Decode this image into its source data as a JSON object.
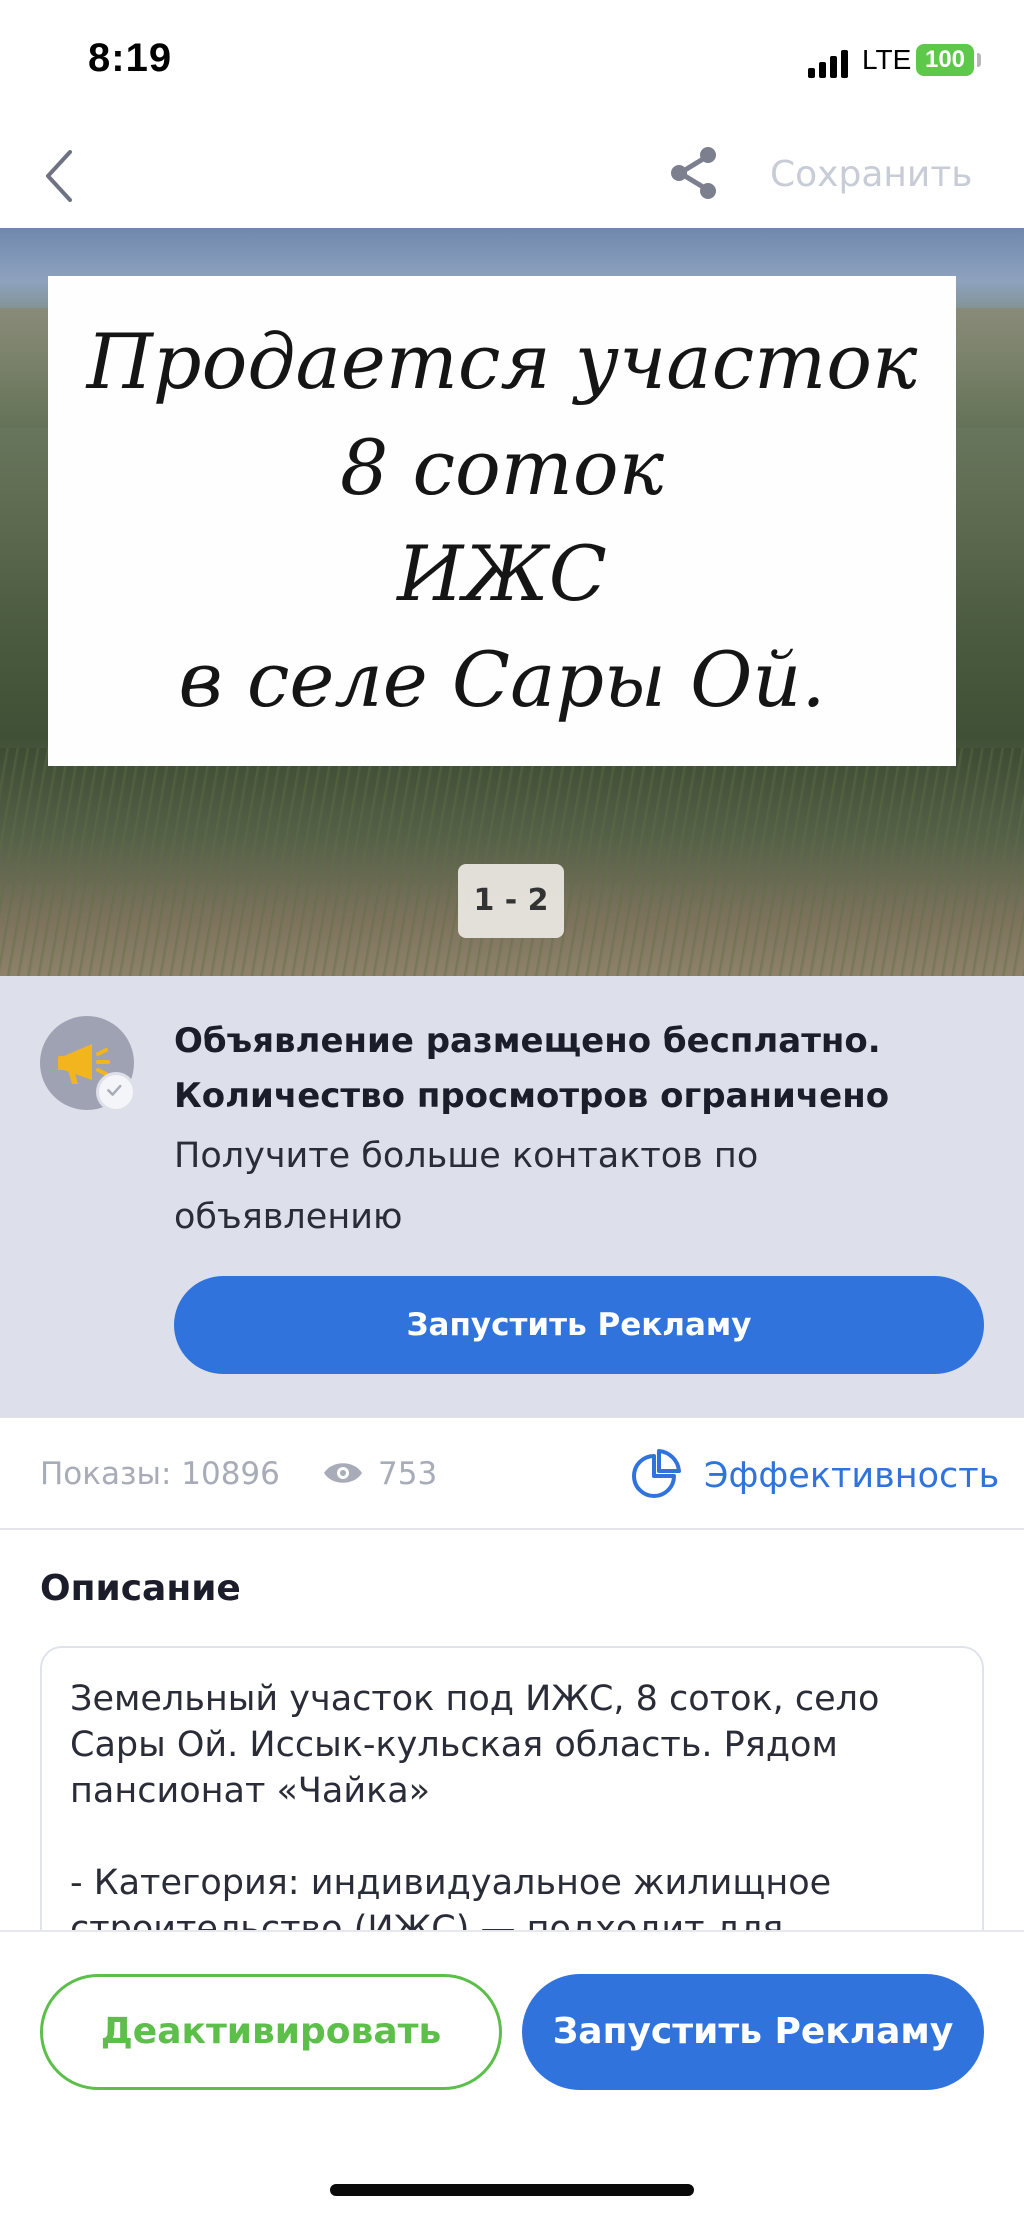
{
  "status_bar": {
    "time": "8:19",
    "network": "LTE",
    "battery": "100",
    "battery_color": "#5dc84a"
  },
  "nav": {
    "back_icon": "chevron-left-icon",
    "share_icon": "share-icon",
    "save_label": "Сохранить"
  },
  "photo": {
    "sign_lines": [
      "Продается участок",
      "8 соток",
      "ИЖС",
      "в селе Сары Ой."
    ],
    "counter": "1 - 2"
  },
  "promo": {
    "icon": "megaphone-icon",
    "title_line1": "Объявление размещено бесплатно.",
    "title_line2": "Количество просмотров ограничено",
    "subtitle": "Получите больше контактов по объявлению",
    "button_label": "Запустить Рекламу"
  },
  "stats": {
    "impressions": "Показы: 10896",
    "views": "753",
    "efficiency_label": "Эффективность"
  },
  "description": {
    "title": "Описание",
    "text": "Земельный участок под ИЖС, 8 соток, село Сары Ой. Иссык-кульская область. Рядом пансионат «Чайка»\n\n- Категория: индивидуальное жилищное строительство (ИЖС) — подходит для"
  },
  "bottom": {
    "deactivate_label": "Деактивировать",
    "advertise_label": "Запустить Рекламу"
  },
  "colors": {
    "accent_blue": "#3073dc",
    "accent_green": "#5bbf4a",
    "promo_bg": "#dde0ea"
  }
}
